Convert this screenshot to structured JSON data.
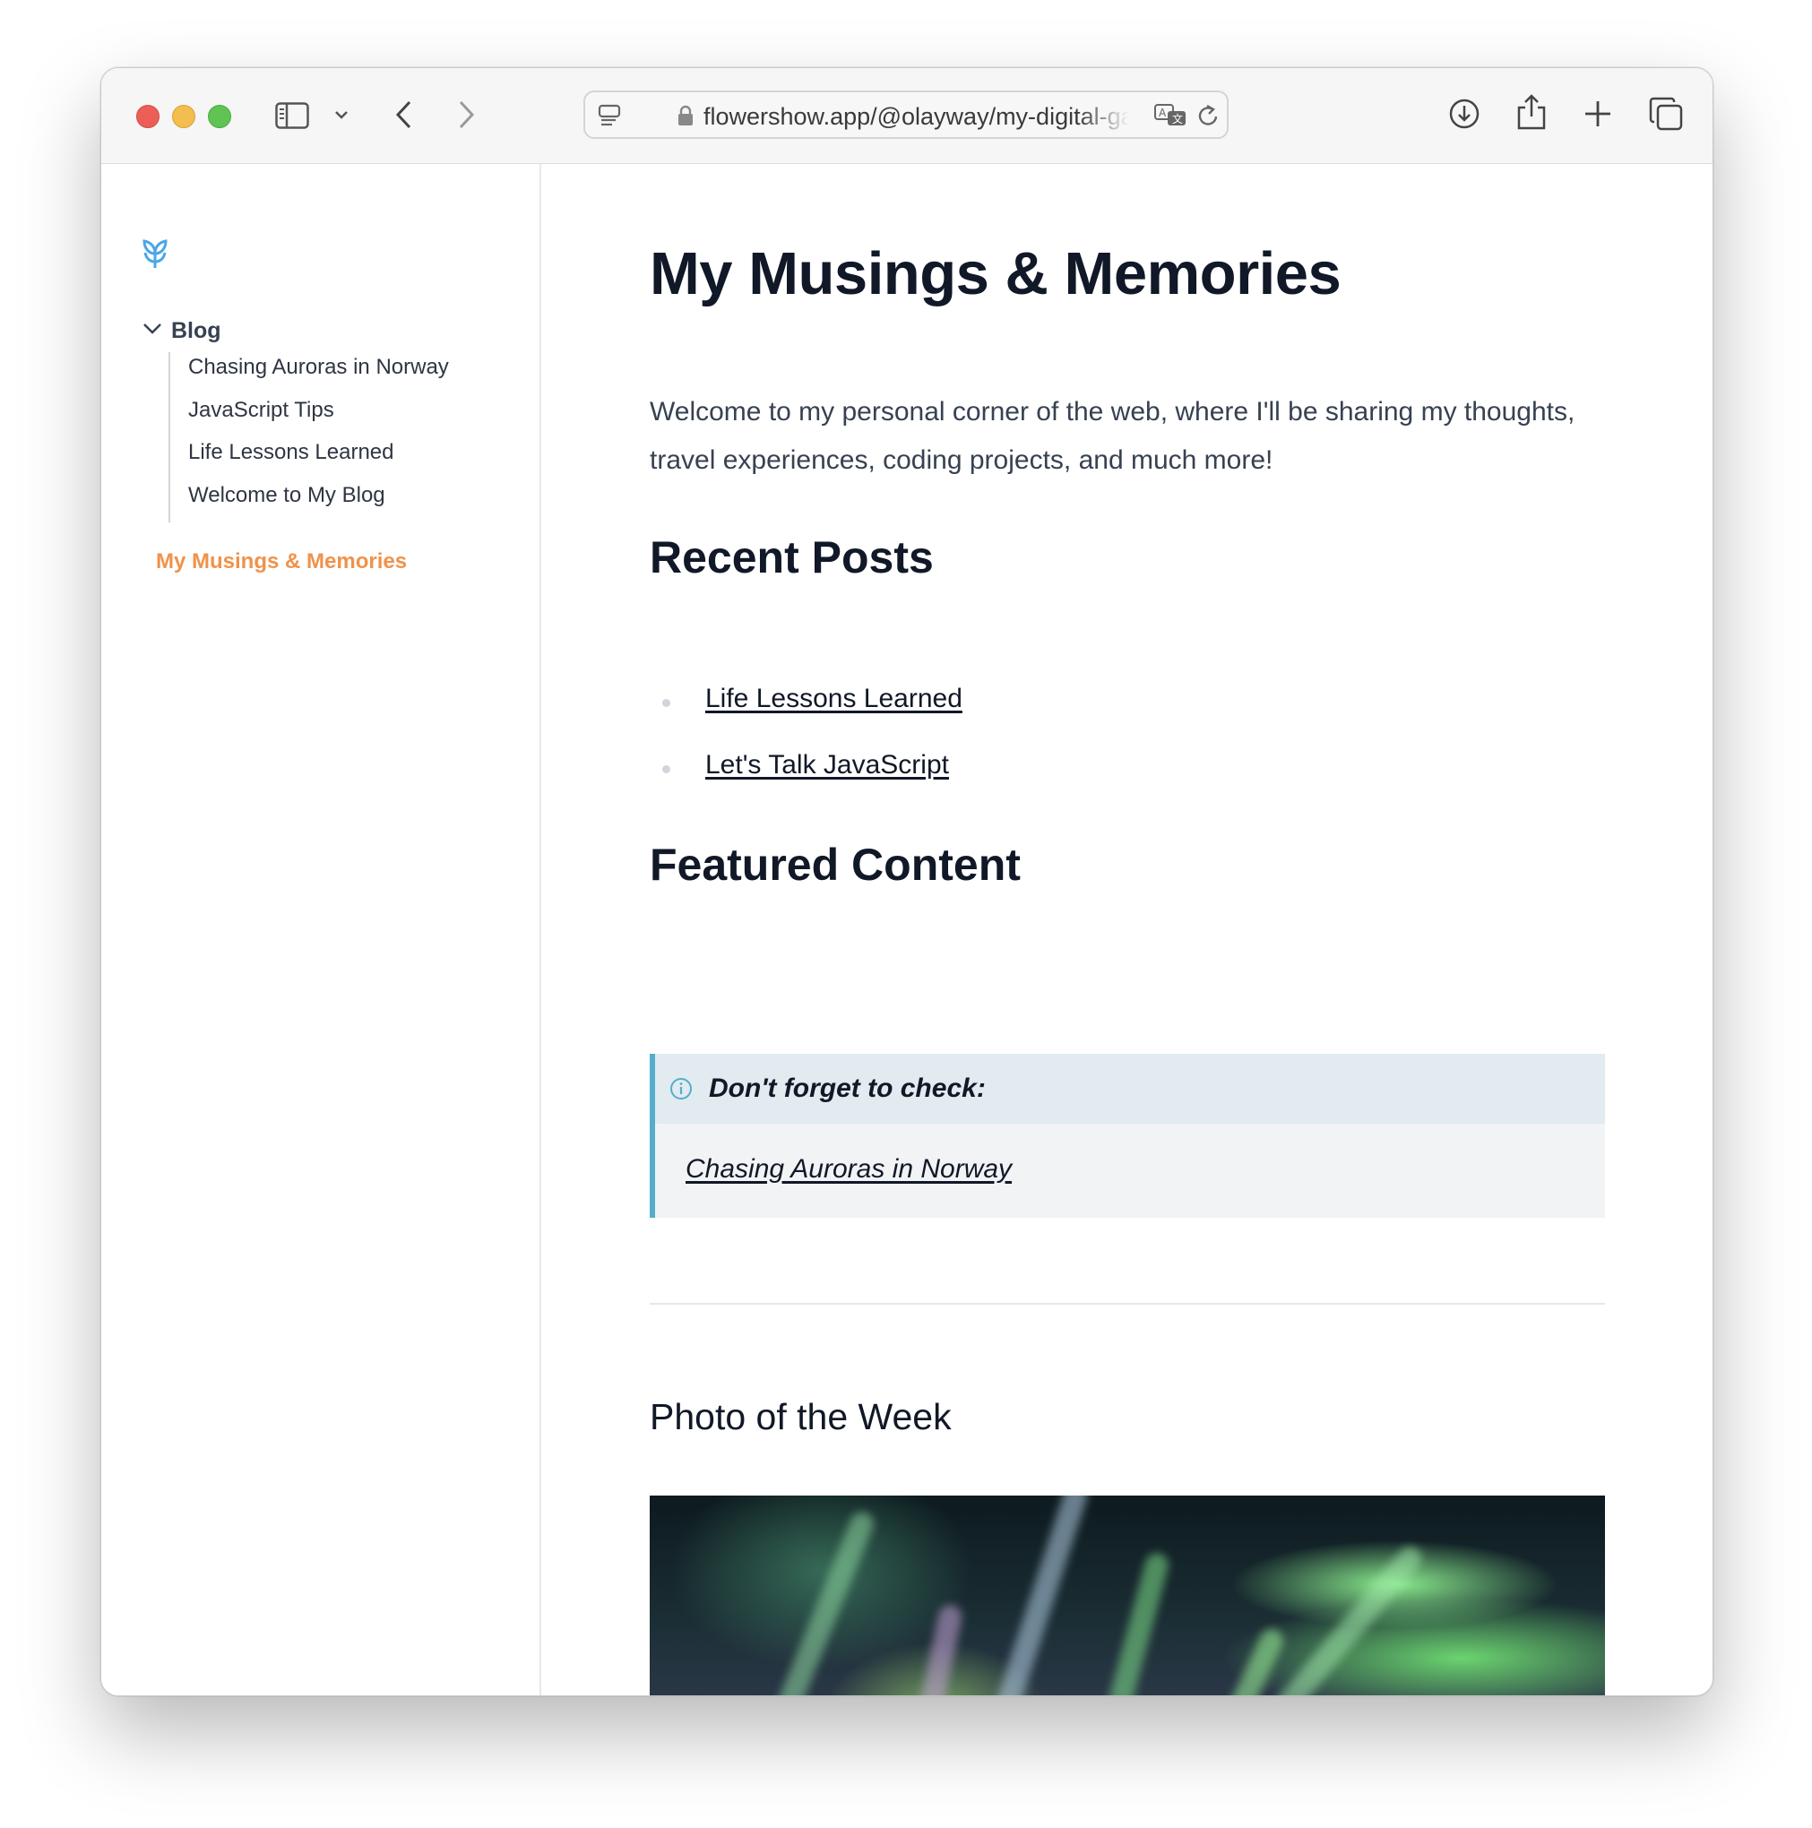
{
  "browser": {
    "url": "flowershow.app/@olayway/my-digital-garden",
    "icons": [
      "sidebar-icon",
      "chevron-down-icon",
      "back-icon",
      "forward-icon",
      "page-menu-icon",
      "lock-icon",
      "translate-icon",
      "reload-icon",
      "download-icon",
      "share-icon",
      "new-tab-icon",
      "tabs-overview-icon"
    ]
  },
  "sidebar": {
    "logo": "flowershow-logo-icon",
    "folder_label": "Blog",
    "items": [
      {
        "label": "Chasing Auroras in Norway"
      },
      {
        "label": "JavaScript Tips"
      },
      {
        "label": "Life Lessons Learned"
      },
      {
        "label": "Welcome to My Blog"
      }
    ],
    "current_page": "My Musings & Memories"
  },
  "page": {
    "title": "My Musings & Memories",
    "intro": "Welcome to my personal corner of the web, where I'll be sharing my thoughts, travel experiences, coding projects, and much more!",
    "recent_posts_heading": "Recent Posts",
    "recent_posts": [
      {
        "label": "Life Lessons Learned"
      },
      {
        "label": "Let's Talk JavaScript"
      }
    ],
    "featured_heading": "Featured Content",
    "callout": {
      "title": "Don't forget to check:",
      "link": "Chasing Auroras in Norway"
    },
    "photo_heading": "Photo of the Week",
    "photo_alt": "aurora-photo"
  },
  "colors": {
    "accent_orange": "#f0924a",
    "logo_blue": "#4aa6e8",
    "callout_border": "#55adcb"
  }
}
